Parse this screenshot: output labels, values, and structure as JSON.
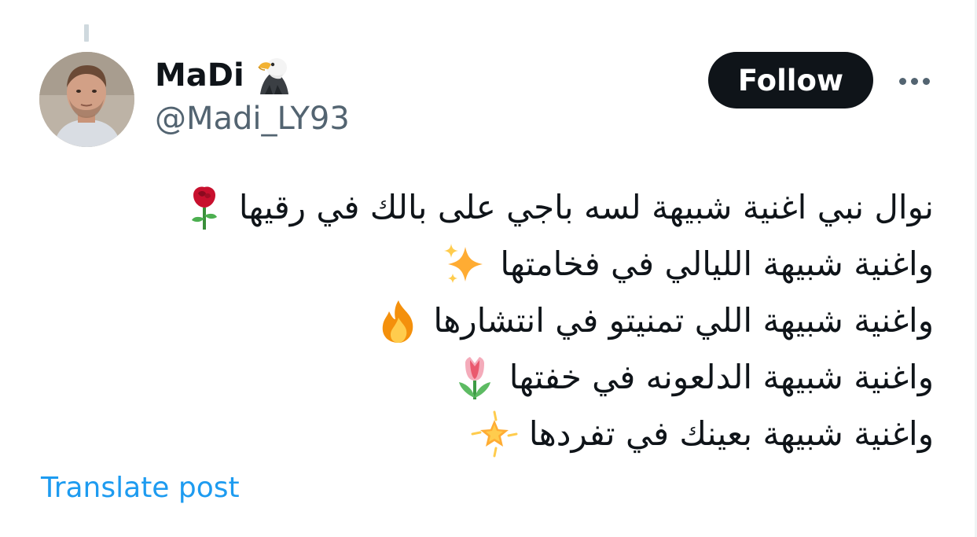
{
  "author": {
    "display_name": "MaDi",
    "name_emoji_icon": "eagle-icon",
    "handle": "@Madi_LY93",
    "avatar": "avatar-photo"
  },
  "actions": {
    "follow_label": "Follow",
    "more_icon": "more-options-icon"
  },
  "tweet": {
    "lines": [
      {
        "text": "نوال نبي اغنية شبيهة لسه باجي على بالك في رقيها",
        "emoji_icon": "rose-icon"
      },
      {
        "text": "واغنية شبيهة الليالي في فخامتها",
        "emoji_icon": "sparkles-icon"
      },
      {
        "text": "واغنية شبيهة اللي تمنيتو في انتشارها",
        "emoji_icon": "fire-icon"
      },
      {
        "text": "واغنية شبيهة الدلعونه في خفتها",
        "emoji_icon": "tulip-icon"
      },
      {
        "text": "واغنية شبيهة بعينك في تفردها",
        "emoji_icon": "glowing-star-icon"
      }
    ]
  },
  "translate_label": "Translate post",
  "colors": {
    "text_primary": "#0f1419",
    "text_secondary": "#536471",
    "link": "#1d9bf0",
    "button_bg": "#0f1419",
    "button_text": "#ffffff"
  }
}
